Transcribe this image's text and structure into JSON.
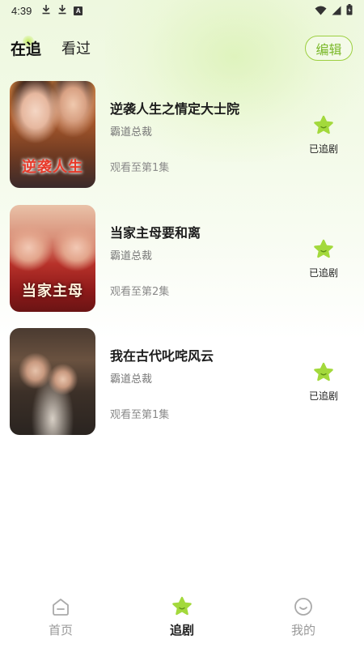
{
  "status_bar": {
    "time": "4:39",
    "icons": [
      "download-icon",
      "download-icon",
      "app-notification-icon",
      "wifi-icon",
      "signal-icon",
      "battery-icon"
    ]
  },
  "tabs": {
    "active": "在追",
    "other": "看过"
  },
  "edit_label": "编辑",
  "items": [
    {
      "title": "逆袭人生之情定大士院",
      "tag": "霸道总裁",
      "progress": "观看至第1集",
      "follow_label": "已追剧",
      "poster_text": "逆袭人生"
    },
    {
      "title": "当家主母要和离",
      "tag": "霸道总裁",
      "progress": "观看至第2集",
      "follow_label": "已追剧",
      "poster_text": "当家主母"
    },
    {
      "title": "我在古代叱咤风云",
      "tag": "霸道总裁",
      "progress": "观看至第1集",
      "follow_label": "已追剧",
      "poster_text": ""
    }
  ],
  "bottom_nav": [
    {
      "label": "首页",
      "icon": "home-icon",
      "active": false
    },
    {
      "label": "追剧",
      "icon": "star-icon",
      "active": true
    },
    {
      "label": "我的",
      "icon": "smile-face-icon",
      "active": false
    }
  ],
  "colors": {
    "accent_green": "#9ccf3f",
    "star_green": "#a3d93c",
    "background_tint": "#eef8df"
  }
}
